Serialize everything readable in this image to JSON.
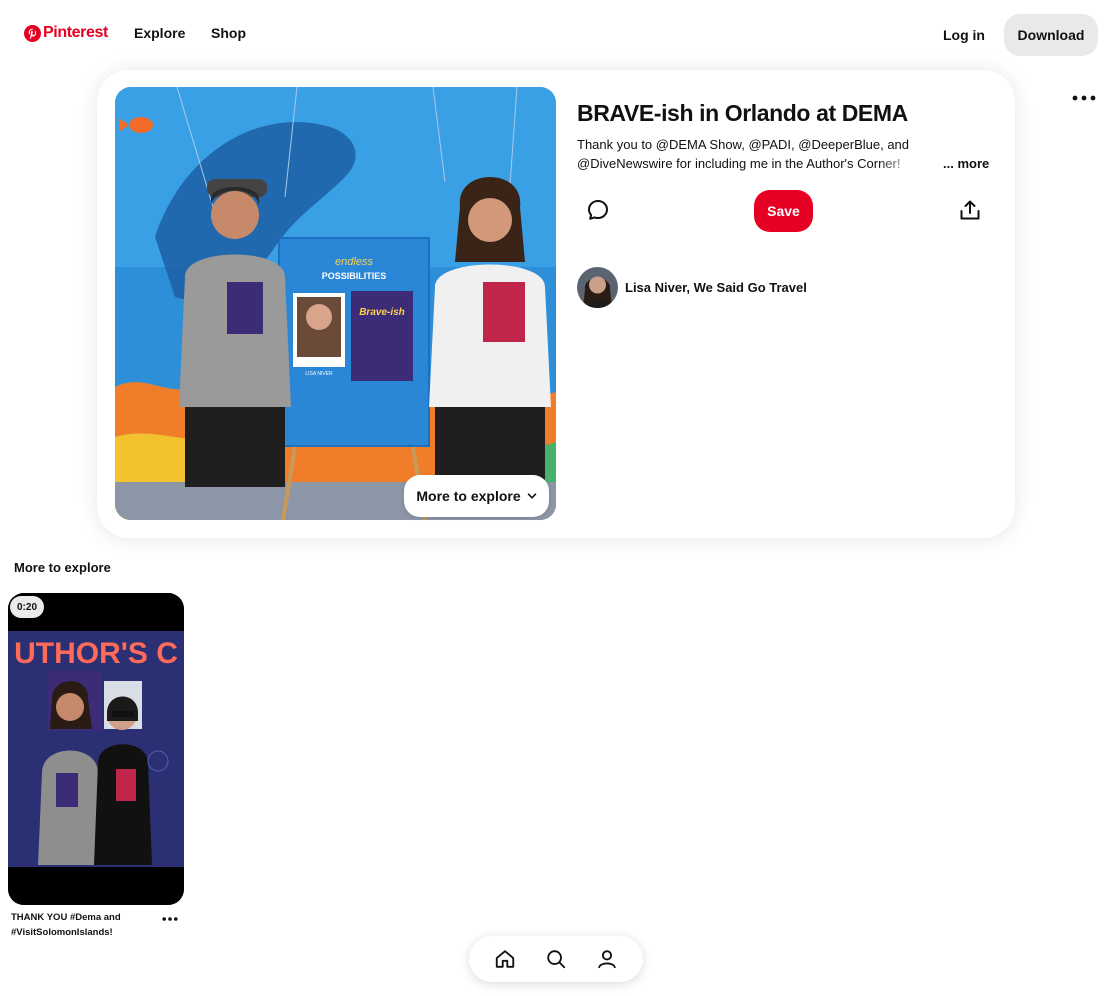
{
  "header": {
    "logo_text": "Pinterest",
    "nav": {
      "explore": "Explore",
      "shop": "Shop"
    },
    "login": "Log in",
    "download": "Download"
  },
  "pin": {
    "title": "BRAVE-ish in Orlando at DEMA",
    "description": "Thank you to @DEMA Show, @PADI, @DeeperBlue, and @DiveNewswire for including me in the Author's Corner!",
    "more": "... more",
    "save_label": "Save",
    "more_to_explore_button": "More to explore",
    "creator": {
      "name": "Lisa Niver, We Said Go Travel"
    },
    "image_text": {
      "poster_heading_1": "endless",
      "poster_heading_2": "POSSIBILITIES",
      "book_title": "Brave-ish",
      "author_label": "LISA NIVER"
    }
  },
  "more_to_explore": {
    "title": "More to explore",
    "items": [
      {
        "duration": "0:20",
        "caption": "THANK YOU #Dema and #VisitSolomonIslands!",
        "image_text": "UTHOR'S C"
      }
    ]
  },
  "colors": {
    "brand": "#e60023",
    "button_gray": "#e9e9e9",
    "text": "#111111"
  },
  "icons": {
    "logo": "pinterest-logo-icon",
    "comment": "comment-icon",
    "share": "share-icon",
    "options": "ellipsis-icon",
    "chevron": "chevron-down-icon",
    "home": "home-icon",
    "search": "search-icon",
    "profile": "profile-icon"
  }
}
